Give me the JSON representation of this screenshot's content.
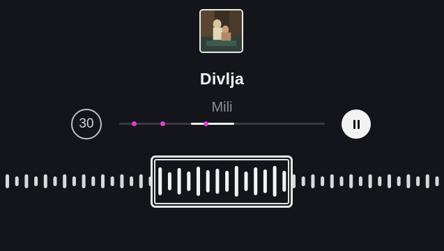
{
  "track": {
    "title": "Divlja",
    "artist": "Mili",
    "cover_icon": "album-cover-photo"
  },
  "controls": {
    "skip_back_label": "30",
    "pause_icon": "pause-icon"
  },
  "progress": {
    "played_fraction_start": 0.35,
    "played_fraction_end": 0.56,
    "markers": [
      0.07,
      0.21,
      0.42
    ]
  },
  "colors": {
    "background": "#14151b",
    "accent": "#e040c8",
    "text": "#f2f2f2",
    "muted": "#8d8e94"
  }
}
